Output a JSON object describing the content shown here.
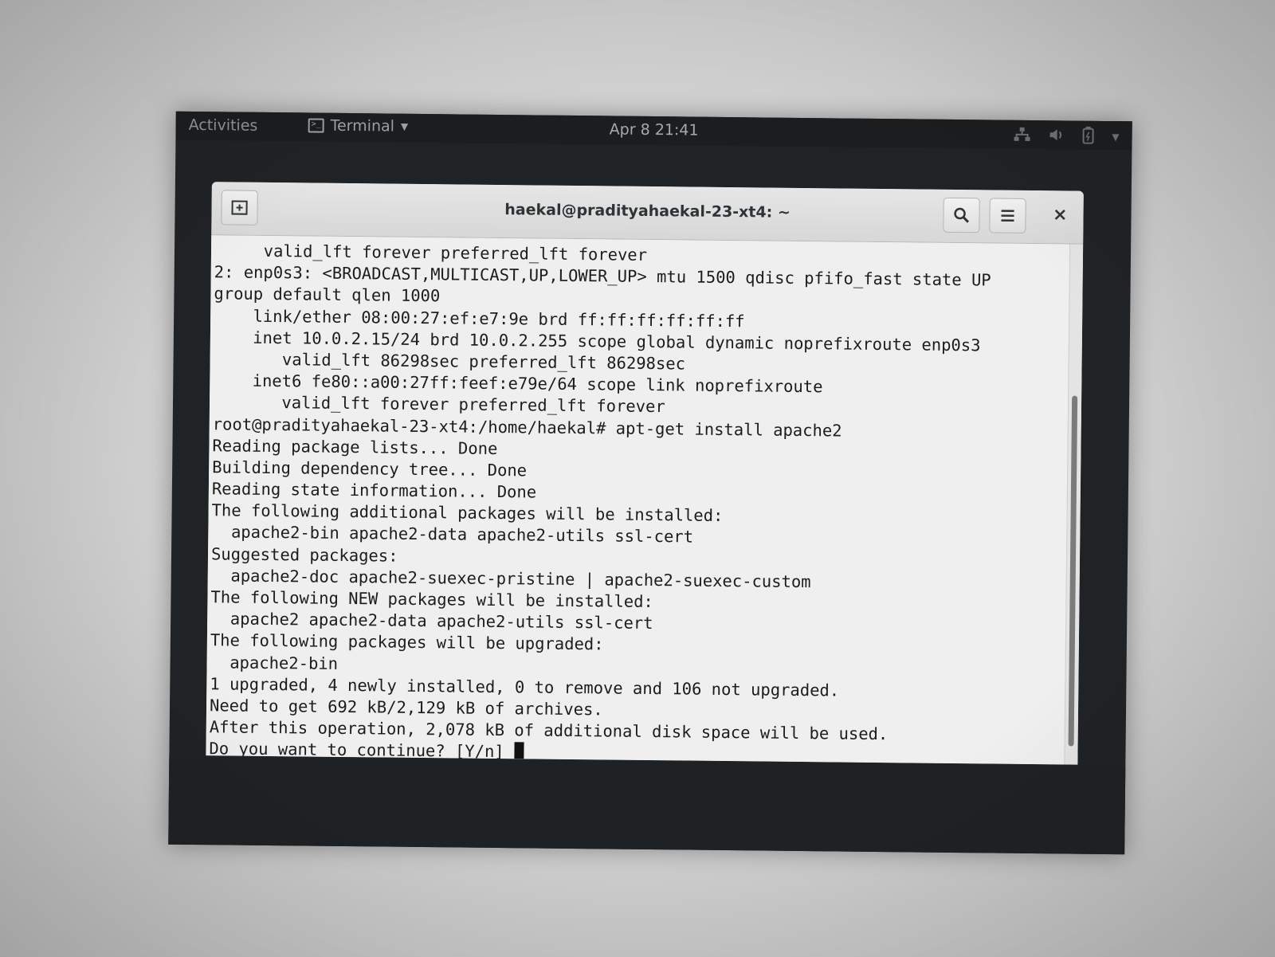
{
  "topbar": {
    "activities": "Activities",
    "app_name": "Terminal",
    "clock": "Apr 8  21:41",
    "icons": [
      "network-icon",
      "volume-icon",
      "battery-icon",
      "system-menu-arrow-icon"
    ]
  },
  "window": {
    "title": "haekal@pradityahaekal-23-xt4: ~",
    "buttons": {
      "new_tab": "new-tab-icon",
      "search": "search-icon",
      "menu": "hamburger-menu-icon",
      "close": "×"
    }
  },
  "terminal": {
    "lines": [
      "     valid_lft forever preferred_lft forever",
      "2: enp0s3: <BROADCAST,MULTICAST,UP,LOWER_UP> mtu 1500 qdisc pfifo_fast state UP",
      "group default qlen 1000",
      "    link/ether 08:00:27:ef:e7:9e brd ff:ff:ff:ff:ff:ff",
      "    inet 10.0.2.15/24 brd 10.0.2.255 scope global dynamic noprefixroute enp0s3",
      "       valid_lft 86298sec preferred_lft 86298sec",
      "    inet6 fe80::a00:27ff:feef:e79e/64 scope link noprefixroute",
      "       valid_lft forever preferred_lft forever",
      "root@pradityahaekal-23-xt4:/home/haekal# apt-get install apache2",
      "Reading package lists... Done",
      "Building dependency tree... Done",
      "Reading state information... Done",
      "The following additional packages will be installed:",
      "  apache2-bin apache2-data apache2-utils ssl-cert",
      "Suggested packages:",
      "  apache2-doc apache2-suexec-pristine | apache2-suexec-custom",
      "The following NEW packages will be installed:",
      "  apache2 apache2-data apache2-utils ssl-cert",
      "The following packages will be upgraded:",
      "  apache2-bin",
      "1 upgraded, 4 newly installed, 0 to remove and 106 not upgraded.",
      "Need to get 692 kB/2,129 kB of archives.",
      "After this operation, 2,078 kB of additional disk space will be used."
    ],
    "prompt_line": "Do you want to continue? [Y/n] "
  },
  "colors": {
    "topbar_bg": "#1b1d1f",
    "terminal_bg": "#efefef",
    "terminal_fg": "#1c1c1c",
    "headerbar_bg": "#dcdcdc"
  }
}
